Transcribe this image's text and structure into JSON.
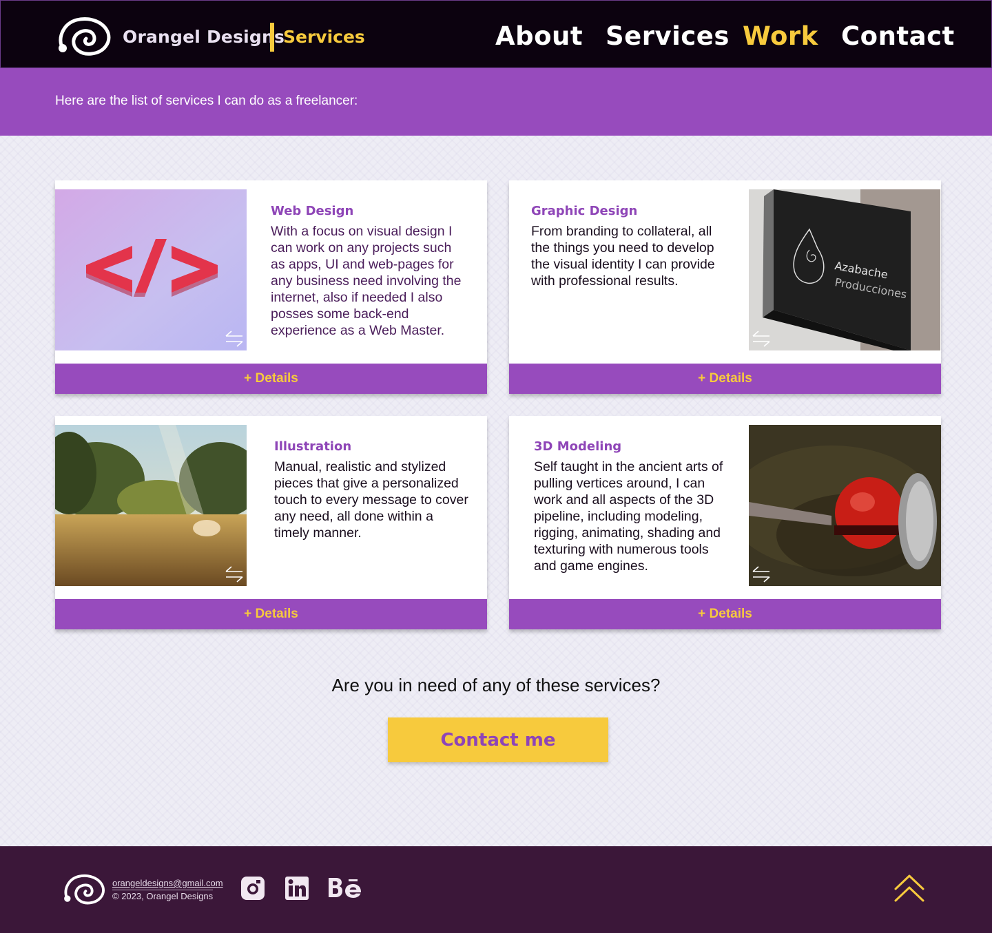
{
  "header": {
    "brand_name": "Orangel Designs",
    "section": "Services",
    "nav": [
      {
        "label": "About",
        "active": false
      },
      {
        "label": "Services",
        "active": false
      },
      {
        "label": "Work",
        "active": true
      },
      {
        "label": "Contact",
        "active": false
      }
    ]
  },
  "intro": {
    "text": "Here are the list of services I can do as a freelancer:"
  },
  "services": [
    {
      "title": "Web Design",
      "description": "With a focus on visual design I can work on any projects such as apps, UI and web-pages for any business need involving the internet, also if needed I also posses some back-end experience as a Web Master.",
      "details_label": "+ Details",
      "image": "code-brackets-icon"
    },
    {
      "title": "Graphic Design",
      "description": "From branding to collateral, all the things you need to develop the visual identity I can provide with professional results.",
      "details_label": "+ Details",
      "image": "azabache-sign",
      "sign_line1": "Azabache",
      "sign_line2": "Producciones"
    },
    {
      "title": "Illustration",
      "description": "Manual, realistic and stylized pieces that give a personalized touch to every message to cover any need, all done within a timely manner.",
      "details_label": "+ Details",
      "image": "landscape-painting"
    },
    {
      "title": "3D Modeling",
      "description": "Self taught in the ancient arts of pulling vertices around, I can work and all aspects of the 3D pipeline, including modeling, rigging, animating, shading and texturing with numerous tools and game engines.",
      "details_label": "+ Details",
      "image": "tomato-render"
    }
  ],
  "cta": {
    "question": "Are you in need of any of these services?",
    "button": "Contact me"
  },
  "footer": {
    "email": "orangeldesigns@gmail.com",
    "copyright": "© 2023, Orangel Designs",
    "social": [
      "instagram-icon",
      "linkedin-icon",
      "behance-icon"
    ]
  },
  "colors": {
    "header_bg": "#0c020f",
    "accent_purple": "#974bbd",
    "accent_yellow": "#f7ca3d",
    "footer_bg": "#3b1739"
  }
}
